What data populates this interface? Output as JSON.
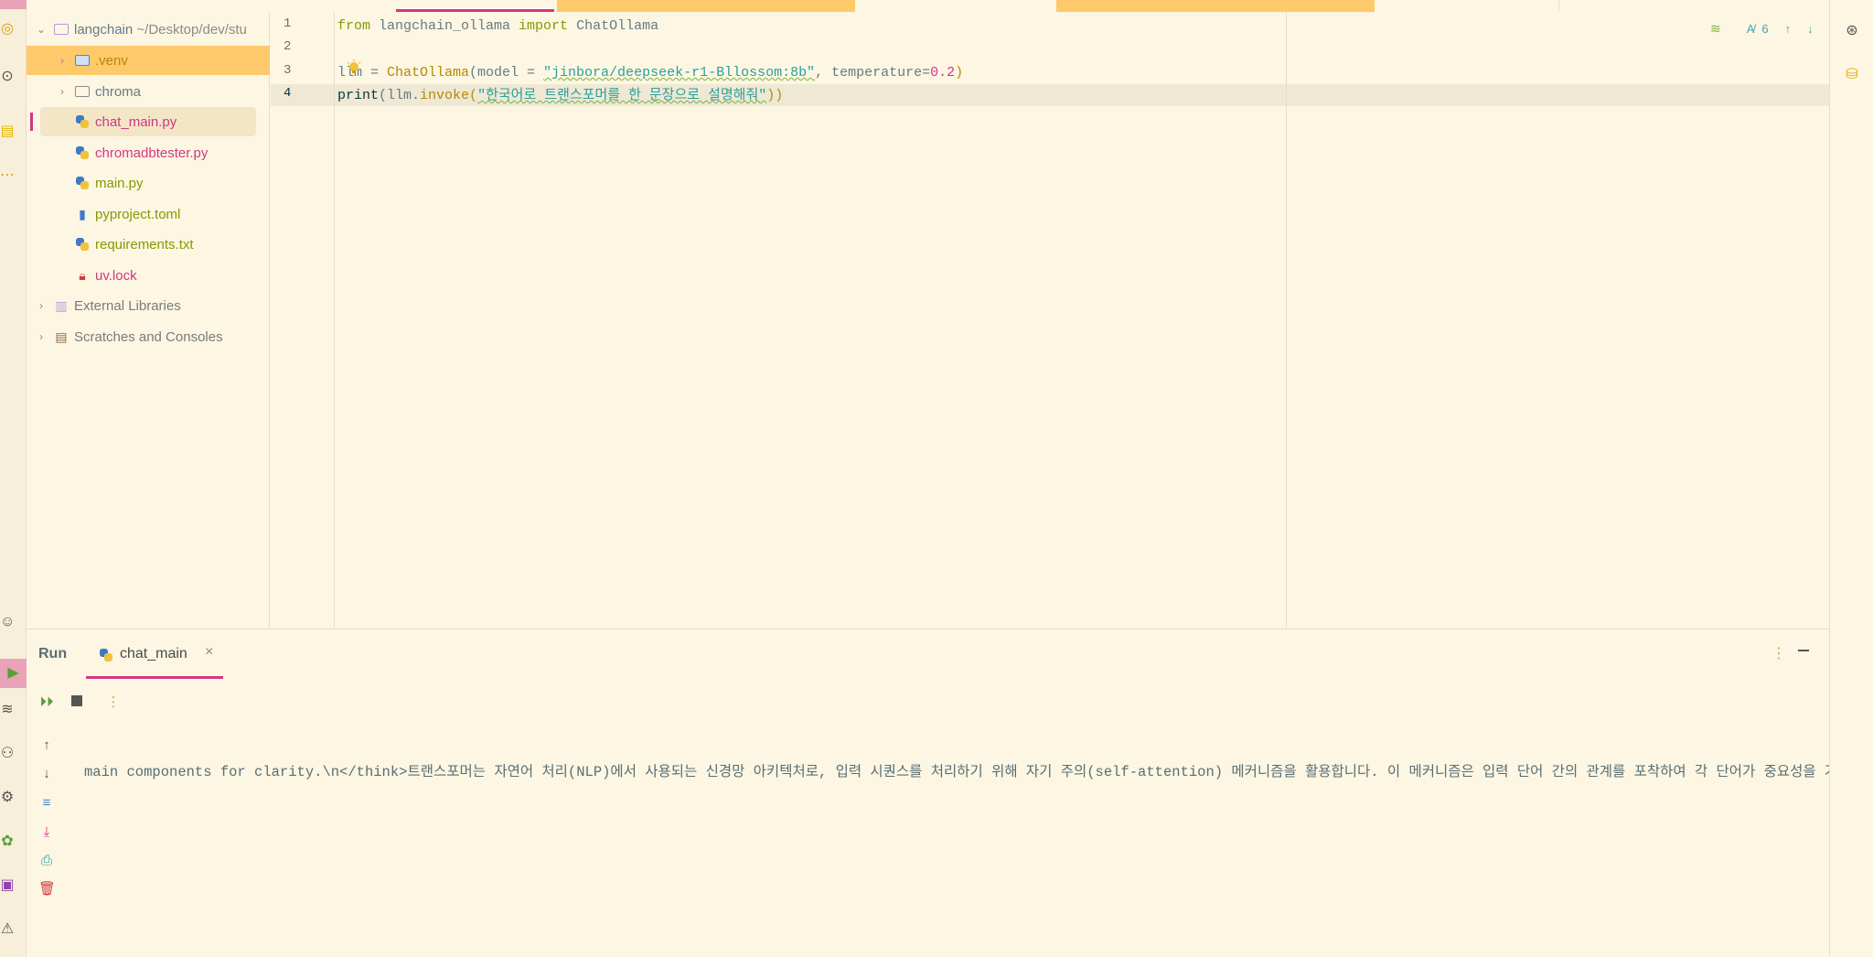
{
  "project": {
    "root": {
      "name": "langchain",
      "path": "~/Desktop/dev/stu"
    },
    "items": [
      {
        "label": "venv",
        "display": ".venv",
        "kind": "folder"
      },
      {
        "label": "chroma",
        "kind": "folder"
      },
      {
        "label": "chat_main.py",
        "kind": "python"
      },
      {
        "label": "chromadbtester.py",
        "kind": "python"
      },
      {
        "label": "main.py",
        "kind": "python"
      },
      {
        "label": "pyproject.toml",
        "kind": "toml"
      },
      {
        "label": "requirements.txt",
        "kind": "python"
      },
      {
        "label": "uv.lock",
        "kind": "lock"
      }
    ],
    "external_libraries": "External Libraries",
    "scratches": "Scratches and Consoles"
  },
  "editor": {
    "line_numbers": [
      "1",
      "2",
      "3",
      "4"
    ],
    "line1": {
      "from": "from",
      "module": " langchain_ollama ",
      "import": "import",
      "name": " ChatOllama"
    },
    "line3": {
      "lhs": "llm = ",
      "call": "ChatOllama",
      "open": "(model = ",
      "model_str": "\"jinbora/deepseek-r1-Bllossom:8b\"",
      "mid": ", temperature=",
      "temp": "0.2",
      "close": ")"
    },
    "line4": {
      "print": "print",
      "open": "(llm.",
      "invoke": "invoke",
      "paren": "(",
      "prompt_str": "\"한국어로 트랜스포머를 한 문장으로 설명해줘\"",
      "close": "))"
    },
    "inspection_count": "6"
  },
  "run_panel": {
    "title": "Run",
    "tab_label": "chat_main",
    "console_output": "main components for clarity.\\n</think>트랜스포머는 자연어 처리(NLP)에서 사용되는 신경망 아키텍처로, 입력 시퀀스를 처리하기 위해 자기 주의(self-attention) 메커니즘을 활용합니다. 이 메커니즘은 입력 단어 간의 관계를 포착하여 각 단어가 중요성을 가중치에 "
  },
  "colors": {
    "background": "#fdf6e3",
    "selection_highlight": "#fec96b",
    "active_accent": "#d33682",
    "current_line": "#eee8d5"
  }
}
